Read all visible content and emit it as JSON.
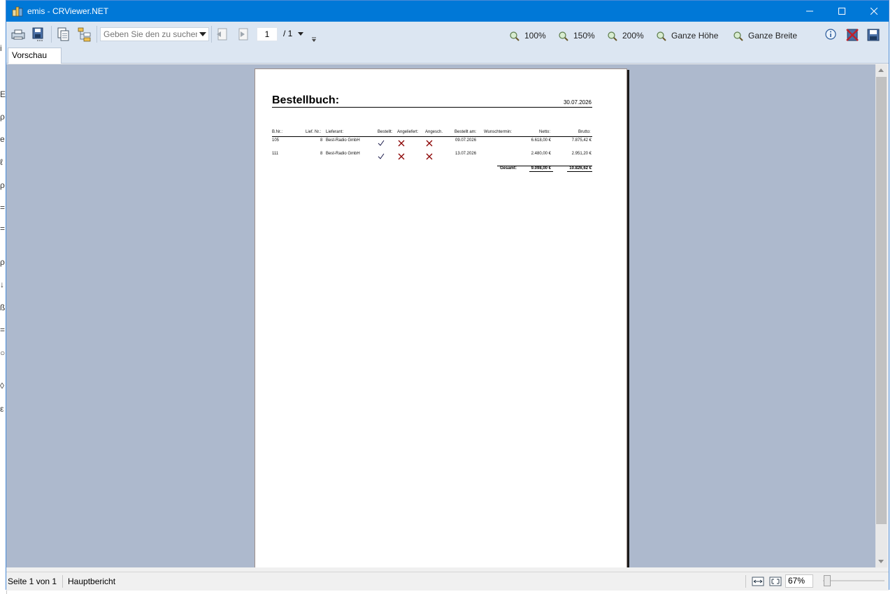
{
  "window": {
    "title": "emis - CRViewer.NET"
  },
  "toolbar": {
    "search_placeholder": "Geben Sie den zu suchen",
    "page_current": "1",
    "page_total": "/ 1",
    "zoom_100": "100%",
    "zoom_150": "150%",
    "zoom_200": "200%",
    "zoom_full_height": "Ganze Höhe",
    "zoom_full_width": "Ganze Breite"
  },
  "tabs": [
    {
      "label": "Vorschau"
    }
  ],
  "report": {
    "title": "Bestellbuch:",
    "date": "30.07.2026",
    "columns": {
      "bnr": "B.Nr.:",
      "liefnr": "Lief. Nr.:",
      "lieferant": "Lieferant:",
      "bestellt": "Bestellt:",
      "angeliefert": "Angeliefert:",
      "angesch": "Angesch.",
      "bestellt_am": "Bestellt am:",
      "wunschtermin": "Wunschtermin:",
      "netto": "Netto:",
      "brutto": "Brutto:"
    },
    "rows": [
      {
        "bnr": "105",
        "liefnr": "8",
        "lieferant": "Best-Radio GmbH",
        "bestellt": "check",
        "angeliefert": "cross",
        "angesch": "cross",
        "bestellt_am": "09.07.2026",
        "wunschtermin": "",
        "netto": "6.618,00 €",
        "brutto": "7.875,42 €"
      },
      {
        "bnr": "111",
        "liefnr": "8",
        "lieferant": "Best-Radio GmbH",
        "bestellt": "check",
        "angeliefert": "cross",
        "angesch": "cross",
        "bestellt_am": "13.07.2026",
        "wunschtermin": "",
        "netto": "2.480,00 €",
        "brutto": "2.951,20 €"
      }
    ],
    "total_label": "Gesamt:",
    "total_netto": "9.098,00 €",
    "total_brutto": "10.826,62 €"
  },
  "statusbar": {
    "page_info": "Seite 1 von 1",
    "report_name": "Hauptbericht",
    "zoom": "67%"
  },
  "colors": {
    "titlebar": "#0078d7",
    "toolbar": "#dce6f2",
    "viewer_bg": "#adb9cd",
    "mark_red": "#8b0000"
  }
}
